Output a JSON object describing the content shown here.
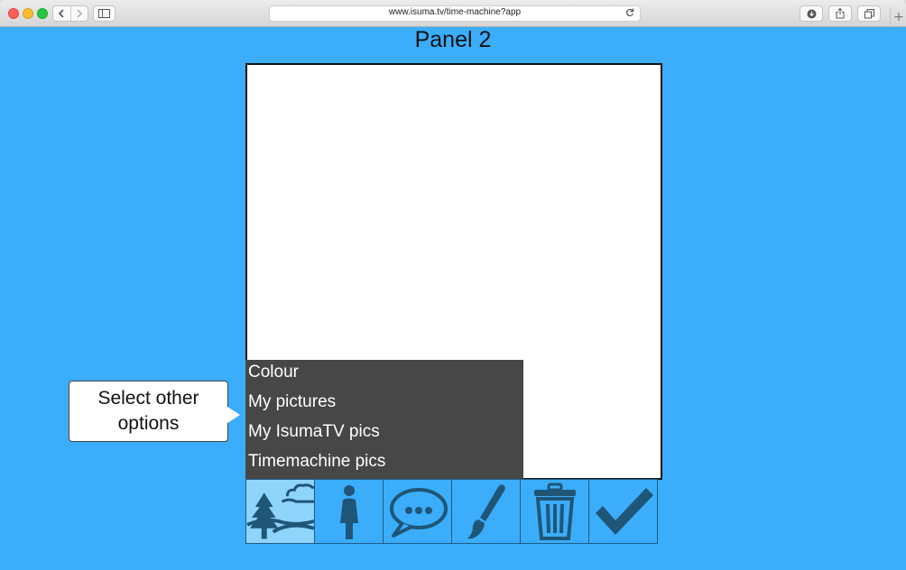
{
  "browser": {
    "url": "www.isuma.tv/time-machine?app",
    "icons": {
      "back": "chevron-left-icon",
      "forward": "chevron-right-icon",
      "sidebar": "sidebar-icon",
      "reload": "reload-icon",
      "download": "download-icon",
      "share": "share-icon",
      "tabs": "tabs-icon",
      "new_tab": "plus-icon"
    }
  },
  "page": {
    "title": "Panel 2",
    "background_color": "#3badfb",
    "menu": {
      "items": [
        {
          "label": "Colour"
        },
        {
          "label": "My pictures"
        },
        {
          "label": "My IsumaTV pics"
        },
        {
          "label": "Timemachine pics"
        }
      ]
    },
    "tools": [
      {
        "icon": "landscape-icon",
        "active": true
      },
      {
        "icon": "person-icon",
        "active": false
      },
      {
        "icon": "speech-bubble-icon",
        "active": false
      },
      {
        "icon": "paintbrush-icon",
        "active": false
      },
      {
        "icon": "trash-icon",
        "active": false
      },
      {
        "icon": "checkmark-icon",
        "active": false
      }
    ],
    "callout": {
      "line1": "Select other",
      "line2": "options"
    }
  }
}
